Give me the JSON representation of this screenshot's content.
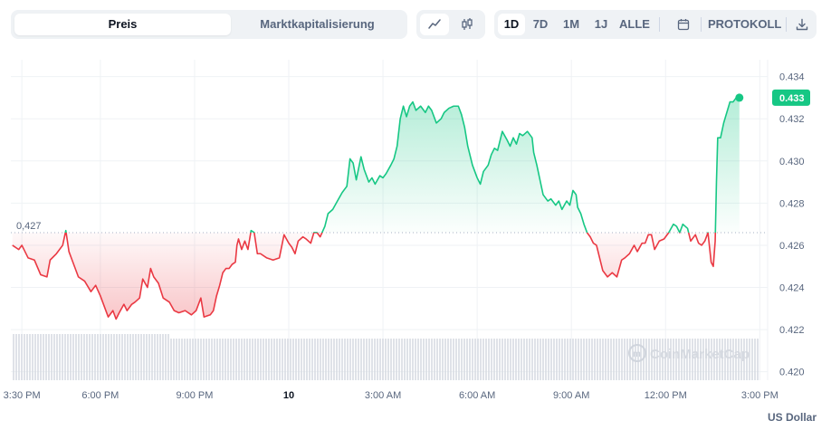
{
  "tabs": [
    {
      "label": "Preis",
      "active": true
    },
    {
      "label": "Marktkapitalisierung",
      "active": false
    }
  ],
  "chart_type_buttons": [
    {
      "icon": "line-chart-icon",
      "active": true
    },
    {
      "icon": "candlestick-icon",
      "active": false
    }
  ],
  "ranges": [
    {
      "label": "1D",
      "active": true
    },
    {
      "label": "7D",
      "active": false
    },
    {
      "label": "1M",
      "active": false
    },
    {
      "label": "1J",
      "active": false
    },
    {
      "label": "ALLE",
      "active": false
    }
  ],
  "calendar_icon": "calendar-icon",
  "log_label": "PROTOKOLL",
  "download_icon": "download-icon",
  "unit_label": "US Dollar",
  "watermark": "CoinMarketCap",
  "colors": {
    "up": "#16c784",
    "down": "#ea3943",
    "grid": "#eff2f5",
    "volume": "#d7dbe2"
  },
  "chart_data": {
    "type": "line",
    "baseline": 0.4266,
    "baseline_label": "0,427",
    "current_price_label": "0.433",
    "ylim": [
      0.4196,
      0.4348
    ],
    "y_ticks": [
      0.434,
      0.432,
      0.43,
      0.428,
      0.426,
      0.424,
      0.422,
      0.42
    ],
    "y_tick_labels": [
      "0.434",
      "0.432",
      "0.430",
      "0.428",
      "0.426",
      "0.424",
      "0.422",
      "0.420"
    ],
    "xlim": [
      -0.35,
      23.75
    ],
    "x_ticks": [
      {
        "t": 0,
        "label": "3:30 PM",
        "bold": false
      },
      {
        "t": 2.5,
        "label": "6:00 PM",
        "bold": false
      },
      {
        "t": 5.5,
        "label": "9:00 PM",
        "bold": false
      },
      {
        "t": 8.5,
        "label": "10",
        "bold": true
      },
      {
        "t": 11.5,
        "label": "3:00 AM",
        "bold": false
      },
      {
        "t": 14.5,
        "label": "6:00 AM",
        "bold": false
      },
      {
        "t": 17.5,
        "label": "9:00 AM",
        "bold": false
      },
      {
        "t": 20.5,
        "label": "12:00 PM",
        "bold": false
      },
      {
        "t": 23.5,
        "label": "3:00 PM",
        "bold": false
      }
    ],
    "series": [
      {
        "points": [
          [
            -0.3,
            0.426
          ],
          [
            -0.1,
            0.4258
          ],
          [
            0.0,
            0.426
          ],
          [
            0.2,
            0.4254
          ],
          [
            0.4,
            0.4253
          ],
          [
            0.6,
            0.4246
          ],
          [
            0.8,
            0.4245
          ],
          [
            0.9,
            0.4253
          ],
          [
            1.1,
            0.4256
          ],
          [
            1.3,
            0.426
          ],
          [
            1.4,
            0.4267
          ],
          [
            1.5,
            0.4257
          ],
          [
            1.6,
            0.4253
          ],
          [
            1.8,
            0.4245
          ],
          [
            2.0,
            0.4243
          ],
          [
            2.2,
            0.4238
          ],
          [
            2.35,
            0.4241
          ],
          [
            2.5,
            0.4236
          ],
          [
            2.65,
            0.423
          ],
          [
            2.75,
            0.4226
          ],
          [
            2.9,
            0.4229
          ],
          [
            3.0,
            0.4225
          ],
          [
            3.1,
            0.4228
          ],
          [
            3.25,
            0.4232
          ],
          [
            3.35,
            0.4229
          ],
          [
            3.5,
            0.4232
          ],
          [
            3.6,
            0.4233
          ],
          [
            3.75,
            0.4235
          ],
          [
            3.85,
            0.4244
          ],
          [
            4.0,
            0.424
          ],
          [
            4.1,
            0.4249
          ],
          [
            4.2,
            0.4245
          ],
          [
            4.35,
            0.4242
          ],
          [
            4.5,
            0.4235
          ],
          [
            4.7,
            0.4233
          ],
          [
            4.85,
            0.4229
          ],
          [
            5.0,
            0.4228
          ],
          [
            5.2,
            0.4229
          ],
          [
            5.4,
            0.4227
          ],
          [
            5.55,
            0.4229
          ],
          [
            5.7,
            0.4235
          ],
          [
            5.8,
            0.4226
          ],
          [
            6.0,
            0.4227
          ],
          [
            6.1,
            0.4229
          ],
          [
            6.2,
            0.4236
          ],
          [
            6.3,
            0.4241
          ],
          [
            6.4,
            0.4247
          ],
          [
            6.5,
            0.4249
          ],
          [
            6.6,
            0.4249
          ],
          [
            6.7,
            0.4251
          ],
          [
            6.8,
            0.4252
          ],
          [
            6.85,
            0.426
          ],
          [
            6.9,
            0.4263
          ],
          [
            7.0,
            0.4258
          ],
          [
            7.1,
            0.4262
          ],
          [
            7.2,
            0.4258
          ],
          [
            7.3,
            0.4267
          ],
          [
            7.4,
            0.4266
          ],
          [
            7.5,
            0.4256
          ],
          [
            7.6,
            0.4256
          ],
          [
            7.8,
            0.4254
          ],
          [
            8.0,
            0.4253
          ],
          [
            8.2,
            0.4254
          ],
          [
            8.35,
            0.4265
          ],
          [
            8.5,
            0.4261
          ],
          [
            8.6,
            0.4259
          ],
          [
            8.7,
            0.4256
          ],
          [
            8.8,
            0.4262
          ],
          [
            8.95,
            0.4264
          ],
          [
            9.05,
            0.4263
          ],
          [
            9.2,
            0.4261
          ],
          [
            9.3,
            0.4266
          ],
          [
            9.4,
            0.4266
          ],
          [
            9.5,
            0.4264
          ],
          [
            9.65,
            0.4269
          ],
          [
            9.75,
            0.4275
          ],
          [
            9.9,
            0.4277
          ],
          [
            10.05,
            0.4281
          ],
          [
            10.2,
            0.4285
          ],
          [
            10.35,
            0.4288
          ],
          [
            10.45,
            0.4301
          ],
          [
            10.55,
            0.4299
          ],
          [
            10.65,
            0.4291
          ],
          [
            10.8,
            0.4302
          ],
          [
            10.9,
            0.4296
          ],
          [
            11.05,
            0.429
          ],
          [
            11.15,
            0.4292
          ],
          [
            11.25,
            0.4289
          ],
          [
            11.4,
            0.4293
          ],
          [
            11.5,
            0.4292
          ],
          [
            11.6,
            0.4294
          ],
          [
            11.75,
            0.4298
          ],
          [
            11.85,
            0.4301
          ],
          [
            11.95,
            0.4307
          ],
          [
            12.05,
            0.432
          ],
          [
            12.15,
            0.4326
          ],
          [
            12.25,
            0.4321
          ],
          [
            12.35,
            0.4326
          ],
          [
            12.45,
            0.4328
          ],
          [
            12.55,
            0.4324
          ],
          [
            12.7,
            0.4326
          ],
          [
            12.85,
            0.4323
          ],
          [
            12.95,
            0.4326
          ],
          [
            13.05,
            0.4324
          ],
          [
            13.2,
            0.4318
          ],
          [
            13.35,
            0.432
          ],
          [
            13.45,
            0.4323
          ],
          [
            13.6,
            0.4325
          ],
          [
            13.75,
            0.4326
          ],
          [
            13.9,
            0.4326
          ],
          [
            14.0,
            0.4322
          ],
          [
            14.1,
            0.4316
          ],
          [
            14.2,
            0.4307
          ],
          [
            14.35,
            0.4298
          ],
          [
            14.5,
            0.4292
          ],
          [
            14.6,
            0.4289
          ],
          [
            14.7,
            0.4295
          ],
          [
            14.85,
            0.4298
          ],
          [
            14.95,
            0.4303
          ],
          [
            15.05,
            0.4306
          ],
          [
            15.15,
            0.4305
          ],
          [
            15.3,
            0.4314
          ],
          [
            15.45,
            0.431
          ],
          [
            15.55,
            0.4307
          ],
          [
            15.65,
            0.4311
          ],
          [
            15.75,
            0.4308
          ],
          [
            15.85,
            0.4313
          ],
          [
            15.95,
            0.4312
          ],
          [
            16.1,
            0.4314
          ],
          [
            16.25,
            0.4311
          ],
          [
            16.3,
            0.4304
          ],
          [
            16.4,
            0.4298
          ],
          [
            16.5,
            0.4291
          ],
          [
            16.6,
            0.4284
          ],
          [
            16.75,
            0.4281
          ],
          [
            16.85,
            0.4282
          ],
          [
            17.0,
            0.4279
          ],
          [
            17.1,
            0.4281
          ],
          [
            17.2,
            0.4277
          ],
          [
            17.35,
            0.4281
          ],
          [
            17.45,
            0.4279
          ],
          [
            17.55,
            0.4286
          ],
          [
            17.65,
            0.4284
          ],
          [
            17.7,
            0.4278
          ],
          [
            17.8,
            0.4275
          ],
          [
            17.9,
            0.427
          ],
          [
            18.0,
            0.4266
          ],
          [
            18.1,
            0.4264
          ],
          [
            18.2,
            0.4261
          ],
          [
            18.3,
            0.426
          ],
          [
            18.4,
            0.4254
          ],
          [
            18.5,
            0.4248
          ],
          [
            18.65,
            0.4245
          ],
          [
            18.8,
            0.4247
          ],
          [
            18.95,
            0.4245
          ],
          [
            19.1,
            0.4253
          ],
          [
            19.2,
            0.4254
          ],
          [
            19.35,
            0.4256
          ],
          [
            19.5,
            0.426
          ],
          [
            19.6,
            0.4257
          ],
          [
            19.75,
            0.4261
          ],
          [
            19.85,
            0.4261
          ],
          [
            19.95,
            0.4265
          ],
          [
            20.05,
            0.4265
          ],
          [
            20.15,
            0.4258
          ],
          [
            20.3,
            0.4262
          ],
          [
            20.45,
            0.4263
          ],
          [
            20.6,
            0.4266
          ],
          [
            20.75,
            0.427
          ],
          [
            20.85,
            0.4269
          ],
          [
            20.95,
            0.4266
          ],
          [
            21.05,
            0.427
          ],
          [
            21.2,
            0.4268
          ],
          [
            21.3,
            0.4262
          ],
          [
            21.45,
            0.4265
          ],
          [
            21.55,
            0.4261
          ],
          [
            21.65,
            0.426
          ],
          [
            21.75,
            0.4262
          ],
          [
            21.85,
            0.4266
          ],
          [
            21.95,
            0.4252
          ],
          [
            22.02,
            0.425
          ],
          [
            22.08,
            0.4262
          ],
          [
            22.12,
            0.429
          ],
          [
            22.16,
            0.4311
          ],
          [
            22.25,
            0.4311
          ],
          [
            22.35,
            0.4318
          ],
          [
            22.45,
            0.4323
          ],
          [
            22.55,
            0.4328
          ],
          [
            22.65,
            0.4328
          ],
          [
            22.75,
            0.433
          ],
          [
            22.85,
            0.433
          ]
        ]
      }
    ]
  }
}
